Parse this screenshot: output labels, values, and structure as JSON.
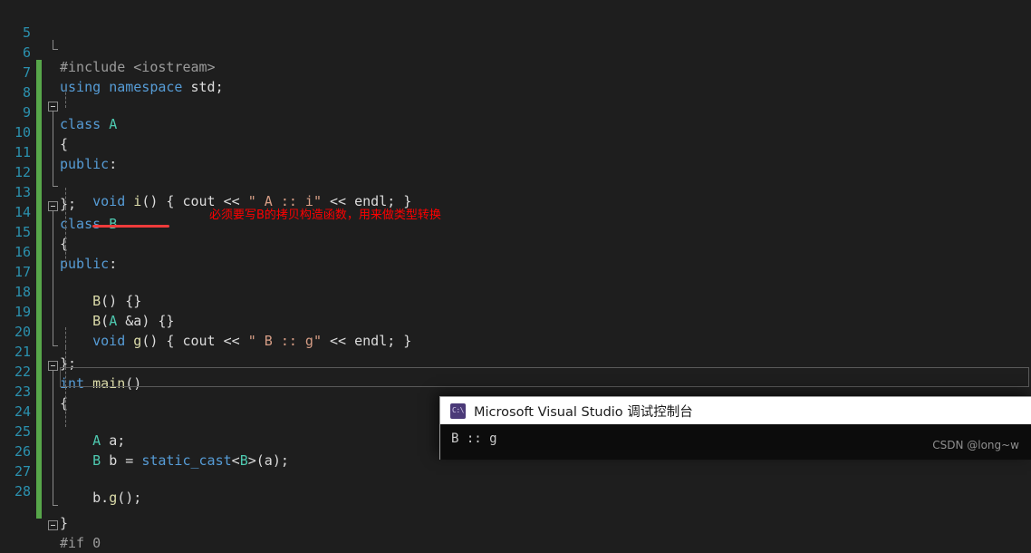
{
  "editor": {
    "theme_background": "#1e1e1e",
    "line_number_color": "#2b91af",
    "change_bar_color": "#57a64a",
    "current_line": 24,
    "lines": [
      {
        "num": "5",
        "text": "#include <iostream>"
      },
      {
        "num": "6",
        "text": "using namespace std;"
      },
      {
        "num": "7",
        "text": "class A"
      },
      {
        "num": "8",
        "text": "{"
      },
      {
        "num": "9",
        "text": "public:"
      },
      {
        "num": "10",
        "text": "    void i() { cout << \" A :: i\" << endl; }"
      },
      {
        "num": "11",
        "text": "};"
      },
      {
        "num": "12",
        "text": "class B"
      },
      {
        "num": "13",
        "text": "{"
      },
      {
        "num": "14",
        "text": "public:"
      },
      {
        "num": "15",
        "text": "    B() {}"
      },
      {
        "num": "16",
        "text": "    B(A &a) {}"
      },
      {
        "num": "17",
        "text": "    void g() { cout << \" B :: g\" << endl; }"
      },
      {
        "num": "18",
        "text": ""
      },
      {
        "num": "19",
        "text": "};"
      },
      {
        "num": "20",
        "text": "int main()"
      },
      {
        "num": "21",
        "text": "{"
      },
      {
        "num": "22",
        "text": "    A a;"
      },
      {
        "num": "23",
        "text": "    B b = static_cast<B>(a);"
      },
      {
        "num": "24",
        "text": "    b.g();"
      },
      {
        "num": "25",
        "text": ""
      },
      {
        "num": "26",
        "text": ""
      },
      {
        "num": "27",
        "text": "}"
      },
      {
        "num": "28",
        "text": "#if 0"
      }
    ]
  },
  "annotation": {
    "text": "必须要写B的拷贝构造函数，用来做类型转换",
    "color": "#ff0000",
    "underline_color": "#ef3b3b",
    "underline_target": "B(A &a) {}"
  },
  "console": {
    "title": "Microsoft Visual Studio 调试控制台",
    "icon": "console-app-icon",
    "icon_label": "C:\\",
    "output": "B :: g"
  },
  "watermark": {
    "text": "CSDN @long~w"
  }
}
